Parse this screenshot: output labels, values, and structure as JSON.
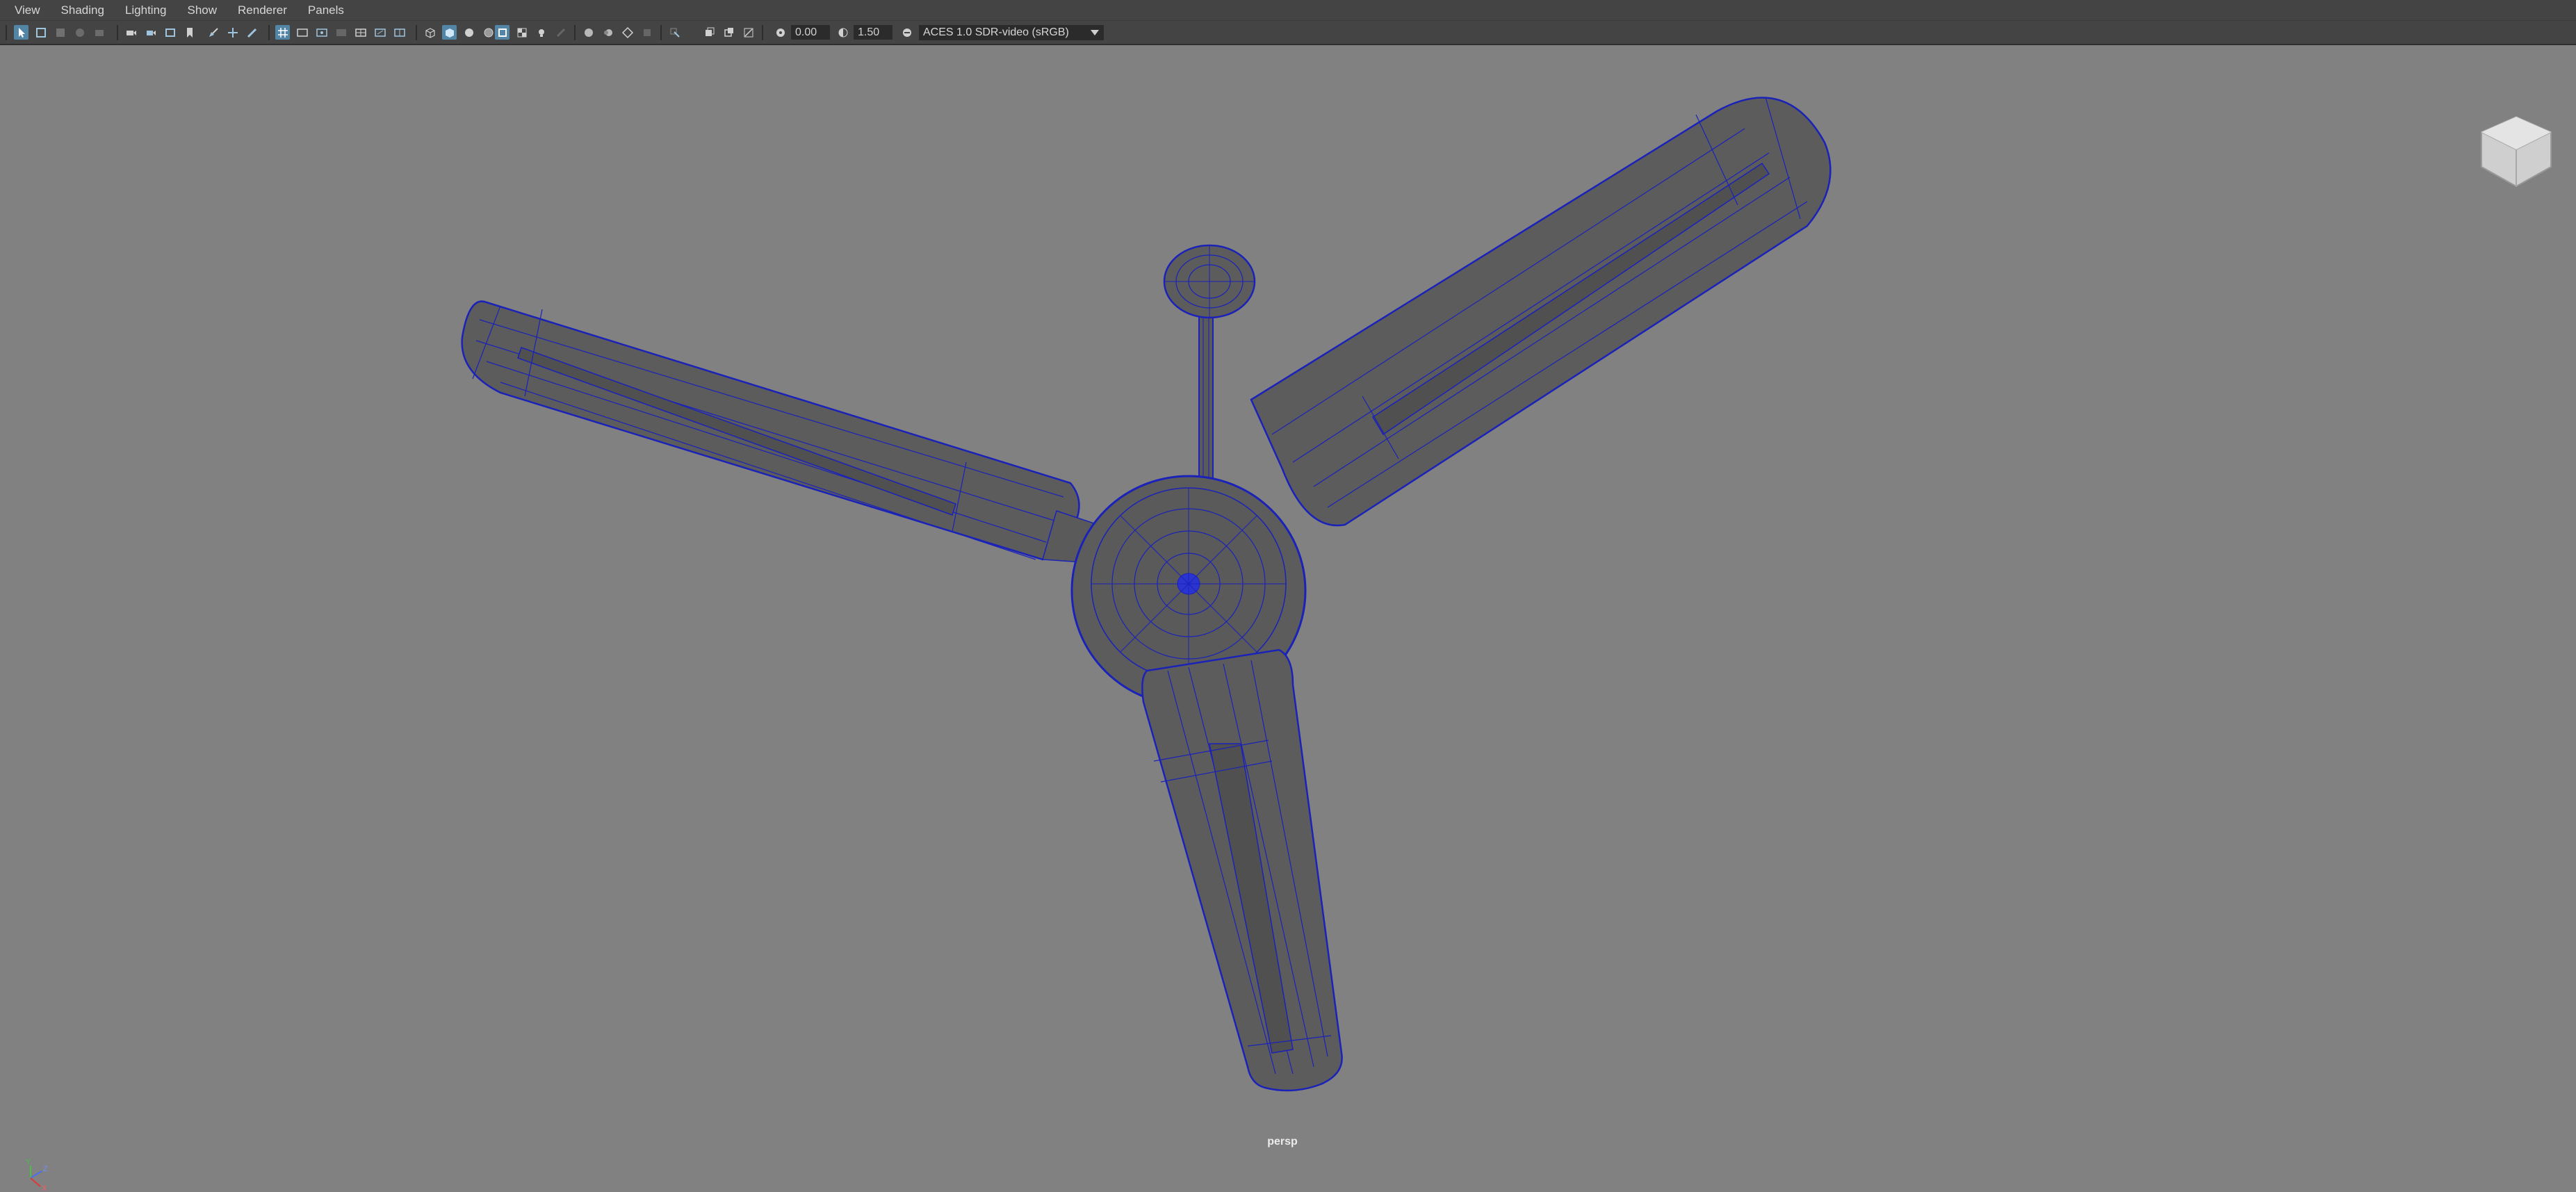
{
  "menubar": {
    "items": [
      "View",
      "Shading",
      "Lighting",
      "Show",
      "Renderer",
      "Panels"
    ]
  },
  "toolbar": {
    "exposure_value": "0.00",
    "gamma_value": "1.50",
    "color_space": "ACES 1.0 SDR-video (sRGB)"
  },
  "viewport": {
    "camera_name": "persp",
    "background_color": "#818181",
    "wire_color": "#1a22b8",
    "mesh_color": "#5a5a5a"
  },
  "icons": {
    "viewcube": "viewcube-icon",
    "axis": "axis-gizmo-icon"
  },
  "axis_labels": {
    "y": "Y",
    "z": "Z",
    "x": "X"
  }
}
